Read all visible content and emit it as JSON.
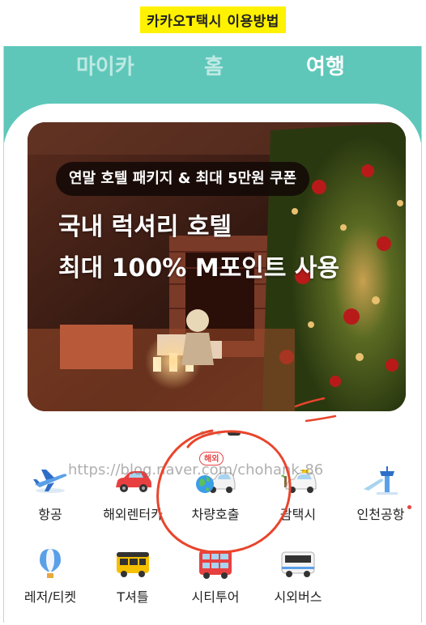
{
  "caption": "카카오T택시 이용방법",
  "tabs": [
    {
      "label": "마이카",
      "active": false
    },
    {
      "label": "홈",
      "active": false
    },
    {
      "label": "여행",
      "active": true
    }
  ],
  "banner": {
    "pill": "연말 호텔 패키지 & 최대 5만원 쿠폰",
    "headline_line1": "국내 럭셔리 호텔",
    "headline_line2": "최대 100% M포인트 사용"
  },
  "pager": {
    "count": 4,
    "active_index": 3
  },
  "services_row1": [
    {
      "label": "항공",
      "icon": "airplane-icon"
    },
    {
      "label": "해외렌터카",
      "icon": "rental-car-icon"
    },
    {
      "label": "차량호출",
      "icon": "car-globe-icon",
      "badge": "해외"
    },
    {
      "label": "괌택시",
      "icon": "taxi-icon"
    },
    {
      "label": "인천공항",
      "icon": "airport-tower-icon",
      "new": true
    }
  ],
  "services_row2": [
    {
      "label": "레저/티켓",
      "icon": "hot-air-balloon-icon"
    },
    {
      "label": "T셔틀",
      "icon": "shuttle-bus-icon"
    },
    {
      "label": "시티투어",
      "icon": "double-decker-bus-icon"
    },
    {
      "label": "시외버스",
      "icon": "intercity-bus-icon"
    }
  ],
  "watermark": "https://blog.naver.com/chohank-86",
  "colors": {
    "header": "#5ec7ba",
    "highlight": "#fff200",
    "annotation": "#e8452c"
  }
}
